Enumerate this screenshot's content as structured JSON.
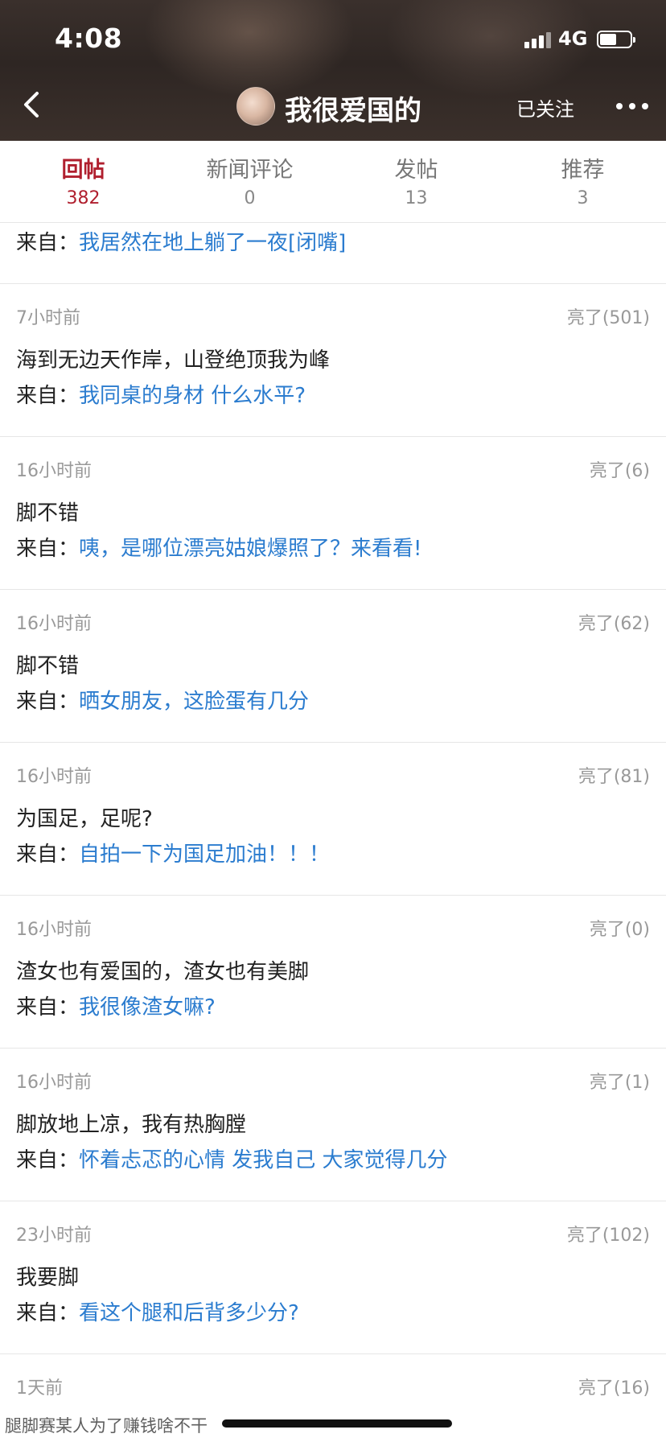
{
  "status_bar": {
    "time": "4:08",
    "network": "4G"
  },
  "header": {
    "nickname": "我很爱国的",
    "follow_label": "已关注"
  },
  "tabs": [
    {
      "label": "回帖",
      "count": "382",
      "active": true
    },
    {
      "label": "新闻评论",
      "count": "0",
      "active": false
    },
    {
      "label": "发帖",
      "count": "13",
      "active": false
    },
    {
      "label": "推荐",
      "count": "3",
      "active": false
    }
  ],
  "partial_item": {
    "source_prefix": "来自：",
    "source_title": "我居然在地上躺了一夜[闭嘴]"
  },
  "items": [
    {
      "time": "7小时前",
      "likes": "亮了(501)",
      "content": "海到无边天作岸，山登绝顶我为峰",
      "source_prefix": "来自：",
      "source_title": "我同桌的身材 什么水平?"
    },
    {
      "time": "16小时前",
      "likes": "亮了(6)",
      "content": "脚不错",
      "source_prefix": "来自：",
      "source_title": "咦，是哪位漂亮姑娘爆照了？来看看!"
    },
    {
      "time": "16小时前",
      "likes": "亮了(62)",
      "content": "脚不错",
      "source_prefix": "来自：",
      "source_title": "晒女朋友，这脸蛋有几分"
    },
    {
      "time": "16小时前",
      "likes": "亮了(81)",
      "content": "为国足，足呢?",
      "source_prefix": "来自：",
      "source_title": "自拍一下为国足加油！！！"
    },
    {
      "time": "16小时前",
      "likes": "亮了(0)",
      "content": "渣女也有爱国的，渣女也有美脚",
      "source_prefix": "来自：",
      "source_title": "我很像渣女嘛?"
    },
    {
      "time": "16小时前",
      "likes": "亮了(1)",
      "content": "脚放地上凉，我有热胸膛",
      "source_prefix": "来自：",
      "source_title": "怀着忐忑的心情 发我自己 大家觉得几分"
    },
    {
      "time": "23小时前",
      "likes": "亮了(102)",
      "content": "我要脚",
      "source_prefix": "来自：",
      "source_title": "看这个腿和后背多少分?"
    },
    {
      "time": "1天前",
      "likes": "亮了(16)",
      "content": "",
      "source_prefix": "",
      "source_title": ""
    }
  ],
  "watermark": "腿脚赛某人为了赚钱啥不干",
  "colors": {
    "accent_red": "#b01f2e",
    "link_blue": "#2b7ccf",
    "header_bg": "#2e2623"
  }
}
